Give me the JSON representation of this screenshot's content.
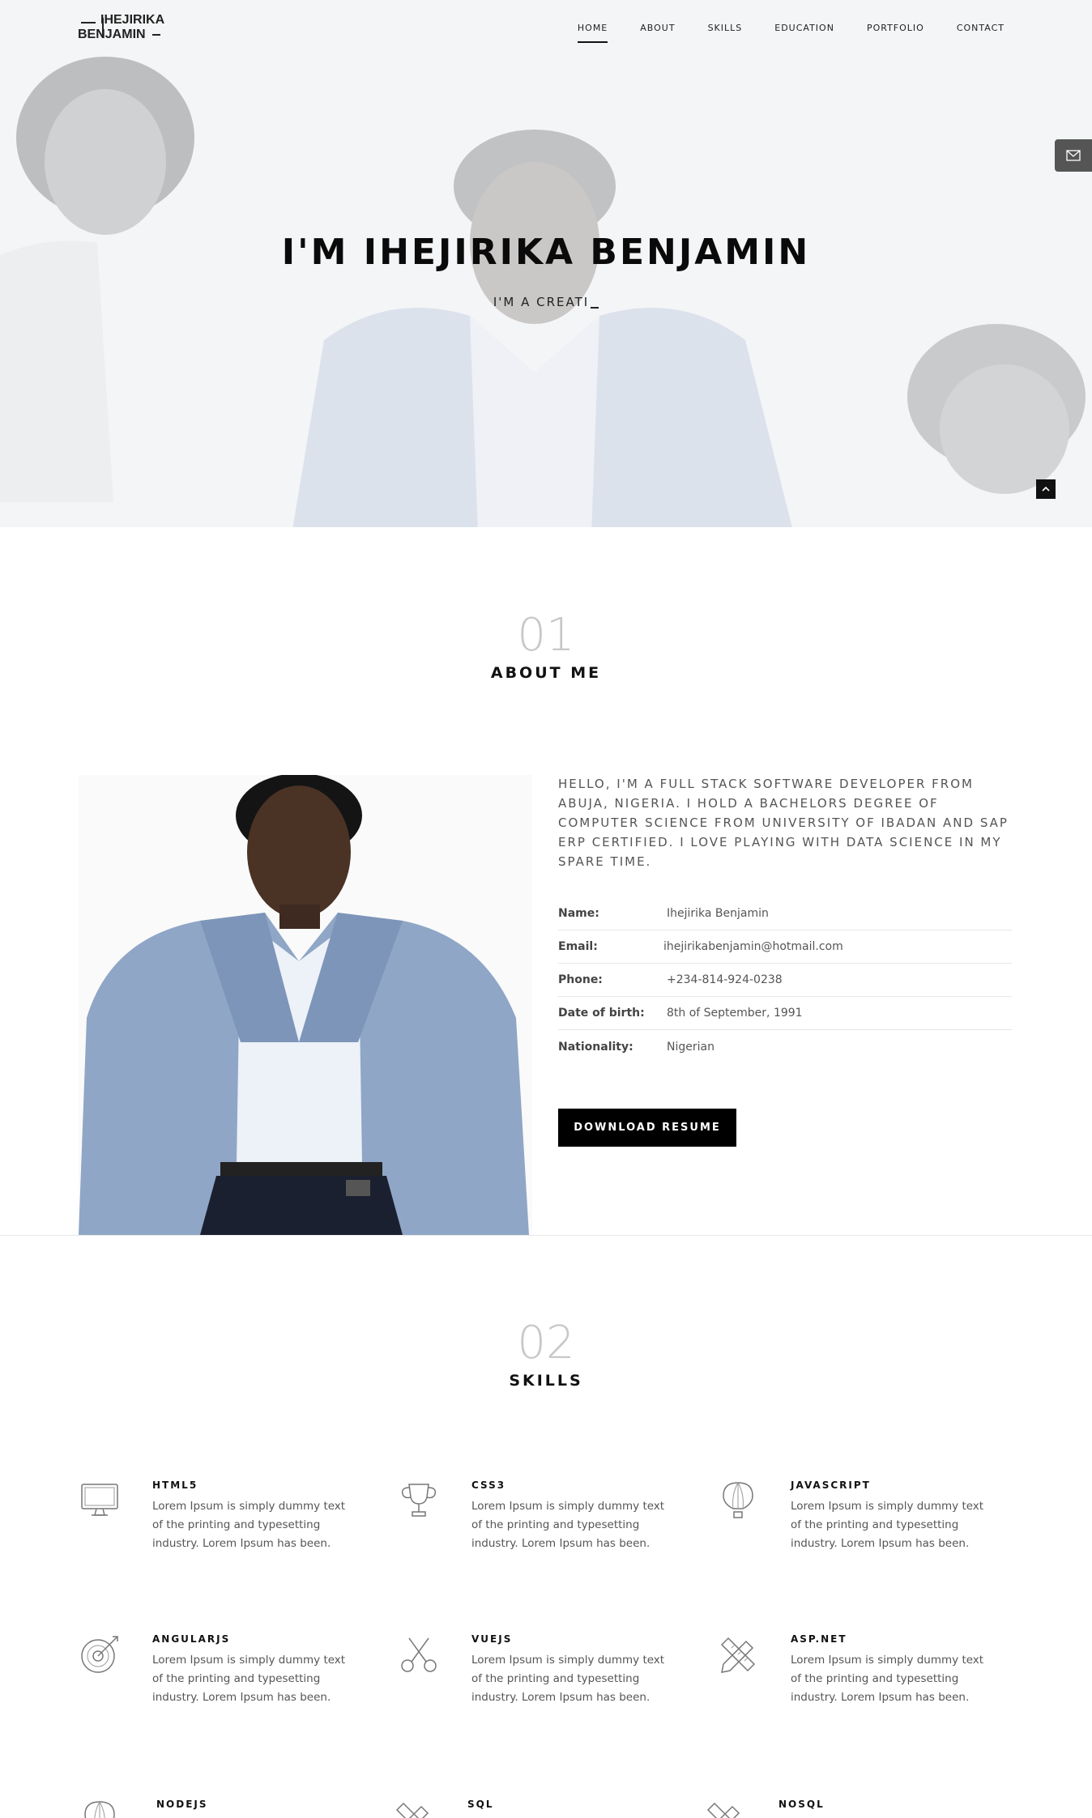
{
  "logo": {
    "line1": "IHEJIRIKA",
    "line2": "BENJAMIN"
  },
  "nav": {
    "items": [
      {
        "label": "HOME",
        "active": true
      },
      {
        "label": "ABOUT"
      },
      {
        "label": "SKILLS"
      },
      {
        "label": "EDUCATION"
      },
      {
        "label": "PORTFOLIO"
      },
      {
        "label": "CONTACT"
      }
    ]
  },
  "hero": {
    "title": "I'M IHEJIRIKA BENJAMIN",
    "subtitle": "I'M A CREATI"
  },
  "about": {
    "number": "01",
    "title": "ABOUT ME",
    "intro": "HELLO, I'M A FULL STACK SOFTWARE DEVELOPER FROM ABUJA, NIGERIA. I HOLD A BACHELORS DEGREE OF COMPUTER SCIENCE FROM UNIVERSITY OF IBADAN AND SAP ERP CERTIFIED. I LOVE PLAYING WITH DATA SCIENCE IN MY SPARE TIME.",
    "info": [
      {
        "key": "Name:",
        "value": "Ihejirika Benjamin"
      },
      {
        "key": "Email:",
        "value": "ihejirikabenjamin@hotmail.com"
      },
      {
        "key": "Phone:",
        "value": "+234-814-924-0238"
      },
      {
        "key": "Date of birth:",
        "value": "8th of September, 1991"
      },
      {
        "key": "Nationality:",
        "value": "Nigerian"
      }
    ],
    "download_label": "DOWNLOAD RESUME"
  },
  "skills": {
    "number": "02",
    "title": "SKILLS",
    "items": [
      {
        "name": "HTML5",
        "icon": "monitor-icon",
        "desc": "Lorem Ipsum is simply dummy text of the printing and typesetting industry. Lorem Ipsum has been."
      },
      {
        "name": "CSS3",
        "icon": "trophy-icon",
        "desc": "Lorem Ipsum is simply dummy text of the printing and typesetting industry. Lorem Ipsum has been."
      },
      {
        "name": "JAVASCRIPT",
        "icon": "hot-air-balloon-icon",
        "desc": "Lorem Ipsum is simply dummy text of the printing and typesetting industry. Lorem Ipsum has been."
      },
      {
        "name": "ANGULARJS",
        "icon": "target-icon",
        "desc": "Lorem Ipsum is simply dummy text of the printing and typesetting industry. Lorem Ipsum has been."
      },
      {
        "name": "VUEJS",
        "icon": "scissors-icon",
        "desc": "Lorem Ipsum is simply dummy text of the printing and typesetting industry. Lorem Ipsum has been."
      },
      {
        "name": "ASP.NET",
        "icon": "pencil-ruler-icon",
        "desc": "Lorem Ipsum is simply dummy text of the printing and typesetting industry. Lorem Ipsum has been."
      },
      {
        "name": "NODEJS",
        "icon": "hot-air-balloon-icon",
        "desc": ""
      },
      {
        "name": "SQL",
        "icon": "pencil-ruler-icon",
        "desc": ""
      },
      {
        "name": "NOSQL",
        "icon": "pencil-ruler-icon",
        "desc": ""
      }
    ]
  }
}
